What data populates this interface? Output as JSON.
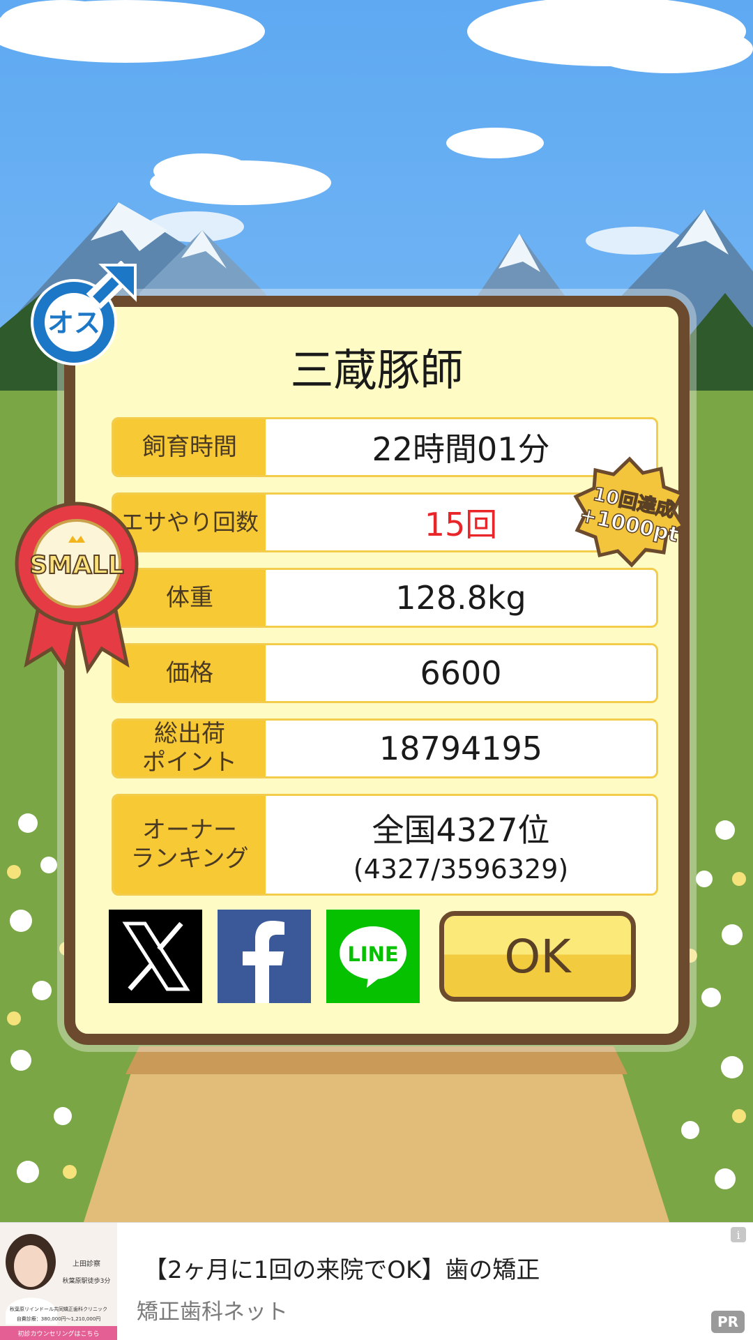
{
  "pig_name": "三蔵豚師",
  "gender_badge": "オス",
  "size_ribbon": "SMALL",
  "achievement_badge": {
    "line1": "10回達成",
    "line2": "+1000pt"
  },
  "stats": [
    {
      "label": "飼育時間",
      "value": "22時間01分"
    },
    {
      "label": "エサやり回数",
      "value": "15回"
    },
    {
      "label": "体重",
      "value": "128.8kg"
    },
    {
      "label": "価格",
      "value": "6600"
    },
    {
      "label": "総出荷\nポイント",
      "value": "18794195"
    },
    {
      "label": "オーナー\nランキング",
      "value": "全国4327位",
      "value_sub": "(4327/3596329)"
    }
  ],
  "share": {
    "x_icon": "x-logo-icon",
    "facebook_icon": "facebook-f-icon",
    "line_label": "LINE"
  },
  "ok_label": "OK",
  "ad": {
    "title": "【2ヶ月に1回の来院でOK】歯の矯正",
    "sponsor": "矯正歯科ネット",
    "pr_label": "PR",
    "info_label": "i",
    "thumb_text1": "上田診察",
    "thumb_text2": "秋葉原駅徒歩3分",
    "thumb_text3": "秋葉原リインドール共同矯正歯科クリニック",
    "thumb_text4": "自費診療：380,000円〜1,210,000円",
    "thumb_cta": "初診カウンセリングはこちら"
  },
  "colors": {
    "panel_bg": "#fefcc4",
    "panel_border": "#6b4a2e",
    "label_bg": "#f7c935",
    "highlight_red": "#e8262a",
    "sky": "#6fb3f0",
    "grass": "#7aa645"
  }
}
